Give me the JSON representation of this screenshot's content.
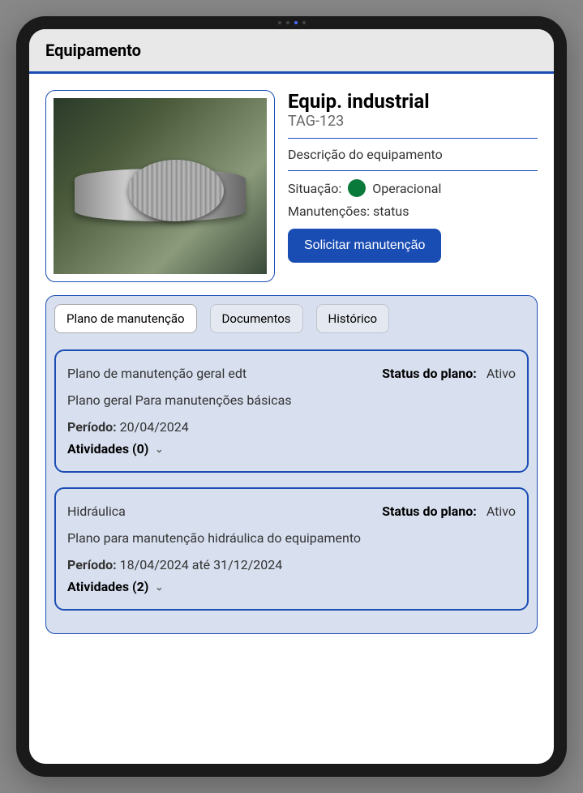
{
  "header": {
    "title": "Equipamento"
  },
  "equipment": {
    "name": "Equip. industrial",
    "tag": "TAG-123",
    "descriptionLabel": "Descrição do equipamento",
    "situationLabel": "Situação:",
    "situationValue": "Operacional",
    "statusColor": "#0a7a3a",
    "maintenanceLabel": "Manutenções: status",
    "requestButton": "Solicitar manutenção"
  },
  "tabs": [
    {
      "label": "Plano de manutenção",
      "active": true
    },
    {
      "label": "Documentos",
      "active": false
    },
    {
      "label": "Histórico",
      "active": false
    }
  ],
  "plans": [
    {
      "title": "Plano de manutenção geral edt",
      "statusLabel": "Status do plano:",
      "statusValue": "Ativo",
      "description": "Plano geral Para manutenções básicas",
      "periodLabel": "Período:",
      "periodValue": "20/04/2024",
      "activitiesLabel": "Atividades (0)"
    },
    {
      "title": "Hidráulica",
      "statusLabel": "Status do plano:",
      "statusValue": "Ativo",
      "description": "Plano para manutenção hidráulica do equipamento",
      "periodLabel": "Período:",
      "periodValue": "18/04/2024 até 31/12/2024",
      "activitiesLabel": "Atividades (2)"
    }
  ]
}
